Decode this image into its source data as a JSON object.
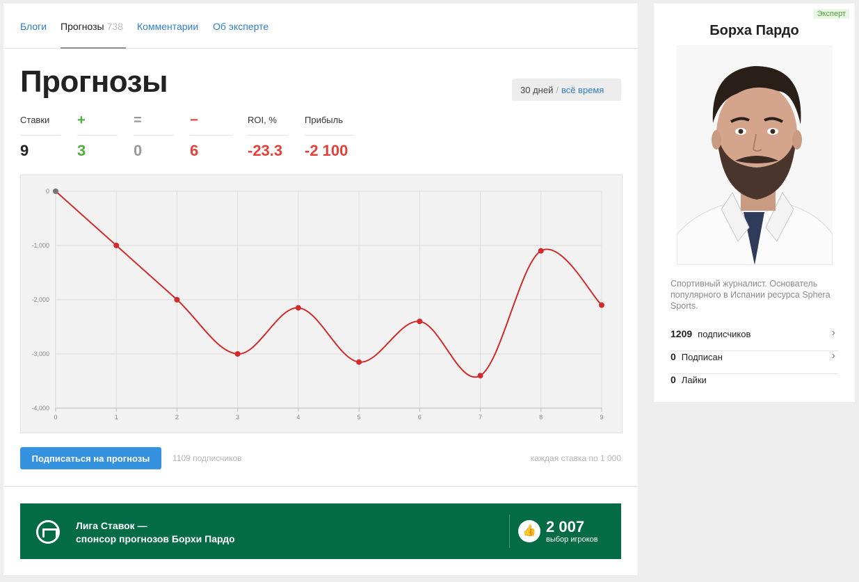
{
  "tabs": [
    {
      "label": "Блоги"
    },
    {
      "label": "Прогнозы",
      "count": "738"
    },
    {
      "label": "Комментарии"
    },
    {
      "label": "Об эксперте"
    }
  ],
  "title": "Прогнозы",
  "period": {
    "days30": "30 дней",
    "separator": "/",
    "all": "всё время"
  },
  "stats": {
    "bets": {
      "label": "Ставки",
      "value": "9"
    },
    "wins": {
      "label": "+",
      "value": "3",
      "color": "#4caf3a"
    },
    "draws": {
      "label": "=",
      "value": "0",
      "color": "#999999"
    },
    "losses": {
      "label": "−",
      "value": "6",
      "color": "#e2403a"
    },
    "roi": {
      "label": "ROI, %",
      "value": "-23.3",
      "color": "#e2403a"
    },
    "profit": {
      "label": "Прибыль",
      "value": "-2 100",
      "color": "#e2403a"
    }
  },
  "chart_data": {
    "type": "line",
    "x": [
      0,
      1,
      2,
      3,
      4,
      5,
      6,
      7,
      8,
      9
    ],
    "series": [
      {
        "values": [
          0,
          -1000,
          -2000,
          -3000,
          -2150,
          -3150,
          -2400,
          -3400,
          -1100,
          -2100
        ],
        "color": "#d12b2b"
      }
    ],
    "ylim": [
      -4000,
      0
    ],
    "yticks": [
      0,
      -1000,
      -2000,
      -3000,
      -4000
    ],
    "ytick_labels": [
      "0",
      "-1,000",
      "-2,000",
      "-3,000",
      "-4,000"
    ],
    "xtick_labels": [
      "0",
      "1",
      "2",
      "3",
      "4",
      "5",
      "6",
      "7",
      "8",
      "9"
    ],
    "grid": true,
    "smooth": true
  },
  "subscribe": {
    "button": "Подписаться на прогнозы",
    "count": "1109 подписчиков",
    "note": "каждая ставка по 1 000"
  },
  "sponsor": {
    "line1": "Лига Ставок —",
    "line2": "спонсор прогнозов Борхи Пардо",
    "count": "2 007",
    "count_label": "выбор игроков",
    "bg": "#046b47"
  },
  "sidebar": {
    "badge": "Эксперт",
    "name": "Борха Пардо",
    "bio": "Спортивный журналист. Основатель популярного в Испании ресурса Sphera Sports.",
    "rows": [
      {
        "num": "1209",
        "label": "подписчиков"
      },
      {
        "num": "0",
        "label": "Подписан"
      },
      {
        "num": "0",
        "label": "Лайки"
      }
    ]
  }
}
